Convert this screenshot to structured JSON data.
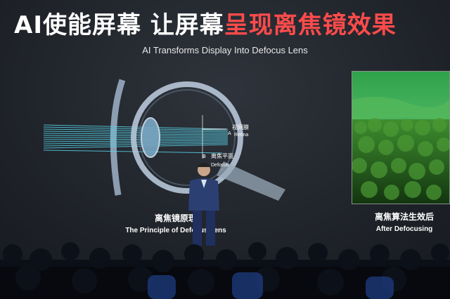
{
  "slide": {
    "title_part1": "AI使能屏幕 ",
    "title_part2": "让屏幕",
    "title_part3": "呈现离焦镜效果",
    "subtitle": "AI Transforms Display Into Defocus Lens"
  },
  "diagram": {
    "label_a_zh": "视网膜",
    "label_a_letter": "A",
    "label_a_en": "Retina",
    "label_b_letter": "B",
    "label_b_zh": "离焦平面",
    "label_b_en": "Defocus"
  },
  "left_caption": {
    "zh": "离焦镜原理",
    "en": "The Principle of Defocus Lens"
  },
  "right_caption": {
    "zh": "离焦算法生效后",
    "en": "After Defocusing"
  },
  "colors": {
    "title_red": "#ff4b4b",
    "ray_cyan": "#59d4e8",
    "forest_green": "#2f7a2a"
  }
}
